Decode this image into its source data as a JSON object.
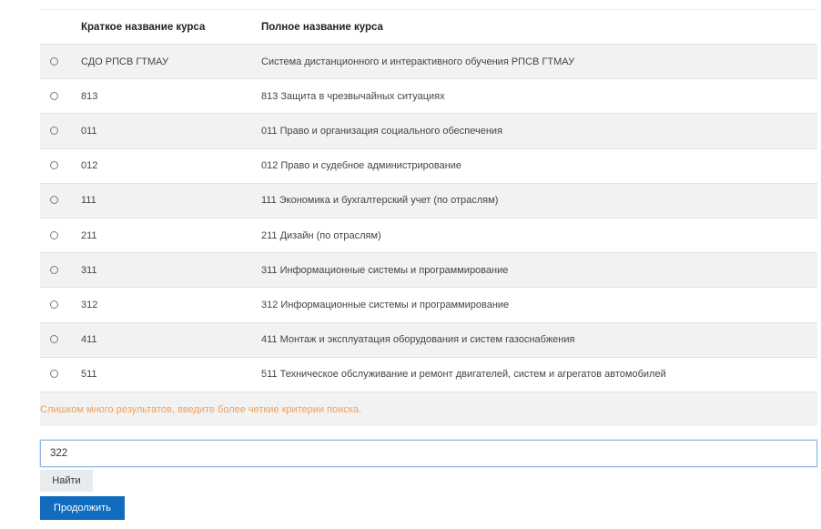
{
  "table": {
    "headers": {
      "radio": "",
      "short": "Краткое название курса",
      "full": "Полное название курса"
    },
    "rows": [
      {
        "short": "СДО РПСВ ГТМАУ",
        "full": "Система дистанционного и интерактивного обучения РПСВ ГТМАУ"
      },
      {
        "short": "813",
        "full": "813 Защита в чрезвычайных ситуациях"
      },
      {
        "short": "011",
        "full": "011 Право и организация социального обеспечения"
      },
      {
        "short": "012",
        "full": "012 Право и судебное администрирование"
      },
      {
        "short": "111",
        "full": "111 Экономика и бухгалтерский учет (по отраслям)"
      },
      {
        "short": "211",
        "full": "211 Дизайн (по отраслям)"
      },
      {
        "short": "311",
        "full": "311 Информационные системы и программирование"
      },
      {
        "short": "312",
        "full": "312 Информационные системы и программирование"
      },
      {
        "short": "411",
        "full": "411 Монтаж и эксплуатация оборудования и систем газоснабжения"
      },
      {
        "short": "511",
        "full": "511 Техническое обслуживание и ремонт двигателей, систем и агрегатов автомобилей"
      }
    ],
    "warning": "Слишком много результатов, введите более четкие критерии поиска."
  },
  "search": {
    "value": "322",
    "placeholder": ""
  },
  "buttons": {
    "find": "Найти",
    "continue": "Продолжить"
  },
  "colors": {
    "primary": "#0f6cbf",
    "warning": "#f0a05a",
    "stripe": "#f2f2f2"
  }
}
